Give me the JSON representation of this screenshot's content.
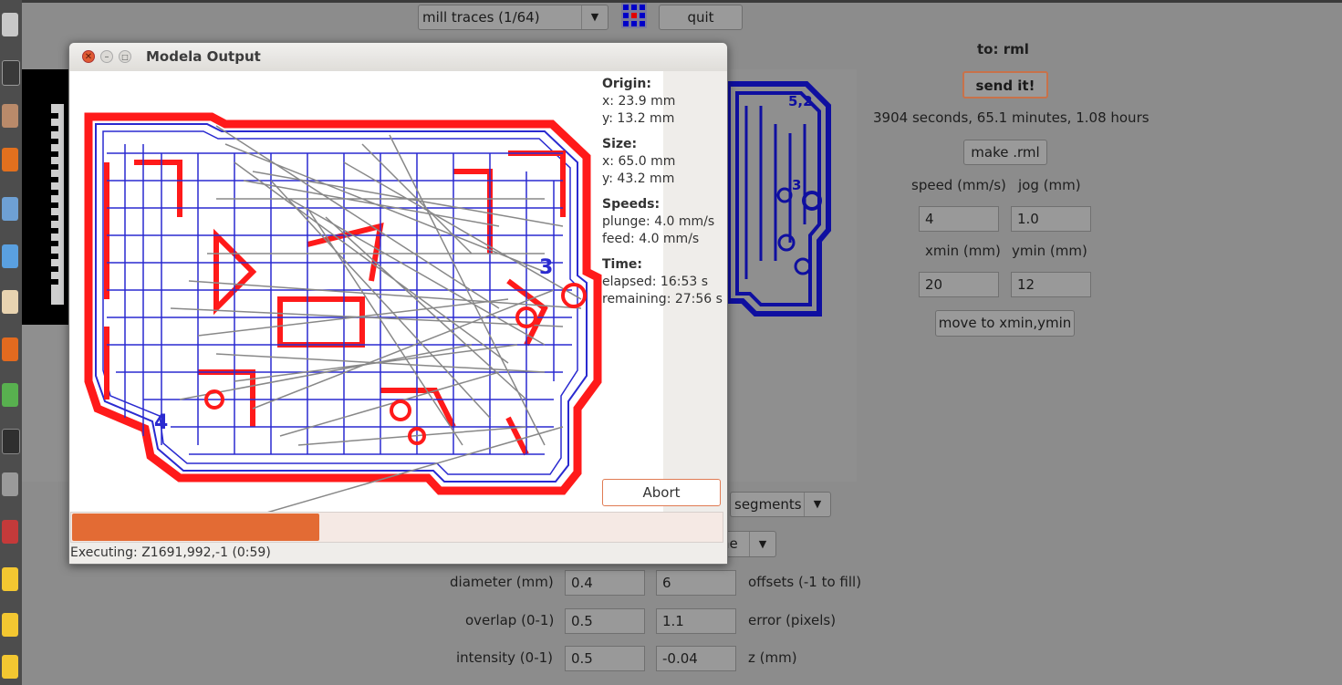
{
  "toolbar": {
    "mode_dropdown": "mill traces (1/64)",
    "quit_label": "quit"
  },
  "right_panel": {
    "to_label": "to: rml",
    "send_label": "send it!",
    "time_estimate": "3904 seconds, 65.1 minutes, 1.08 hours",
    "make_rml_label": "make .rml",
    "speed_label": "speed (mm/s)",
    "jog_label": "jog (mm)",
    "speed_value": "4",
    "jog_value": "1.0",
    "xmin_label": "xmin (mm)",
    "ymin_label": "ymin (mm)",
    "xmin_value": "20",
    "ymin_value": "12",
    "move_label": "move to xmin,ymin"
  },
  "lower_panel": {
    "segments_dropdown": "segments",
    "second_dropdown_partial": "ne",
    "diameter_label": "diameter (mm)",
    "diameter_value": "0.4",
    "offsets_value": "6",
    "offsets_label": "offsets (-1 to fill)",
    "overlap_label": "overlap (0-1)",
    "overlap_value": "0.5",
    "error_value": "1.1",
    "error_label": "error (pixels)",
    "intensity_label": "intensity (0-1)",
    "intensity_value": "0.5",
    "z_value": "-0.04",
    "z_label": "z (mm)"
  },
  "dialog": {
    "title": "Modela Output",
    "origin_heading": "Origin:",
    "origin_x": "x: 23.9 mm",
    "origin_y": "y: 13.2 mm",
    "size_heading": "Size:",
    "size_x": "x: 65.0 mm",
    "size_y": "y: 43.2 mm",
    "speeds_heading": "Speeds:",
    "plunge": "plunge: 4.0 mm/s",
    "feed": "feed: 4.0 mm/s",
    "time_heading": "Time:",
    "elapsed": "elapsed: 16:53 s",
    "remaining": "remaining: 27:56 s",
    "abort_label": "Abort",
    "progress_fraction": 0.38,
    "status": "Executing: Z1691,992,-1 (0:59)"
  },
  "plot_marks": {
    "pad_label_3": "3",
    "pad_label_4": "4",
    "bg_label_3": "3",
    "bg_label_52": "5,2"
  },
  "colors": {
    "toolpath_red": "#ff1a1a",
    "toolpath_blue": "#2a2ad0",
    "travel_gray": "#888888",
    "progress": "#e36b34",
    "bg_blue": "#0f0fa0"
  }
}
